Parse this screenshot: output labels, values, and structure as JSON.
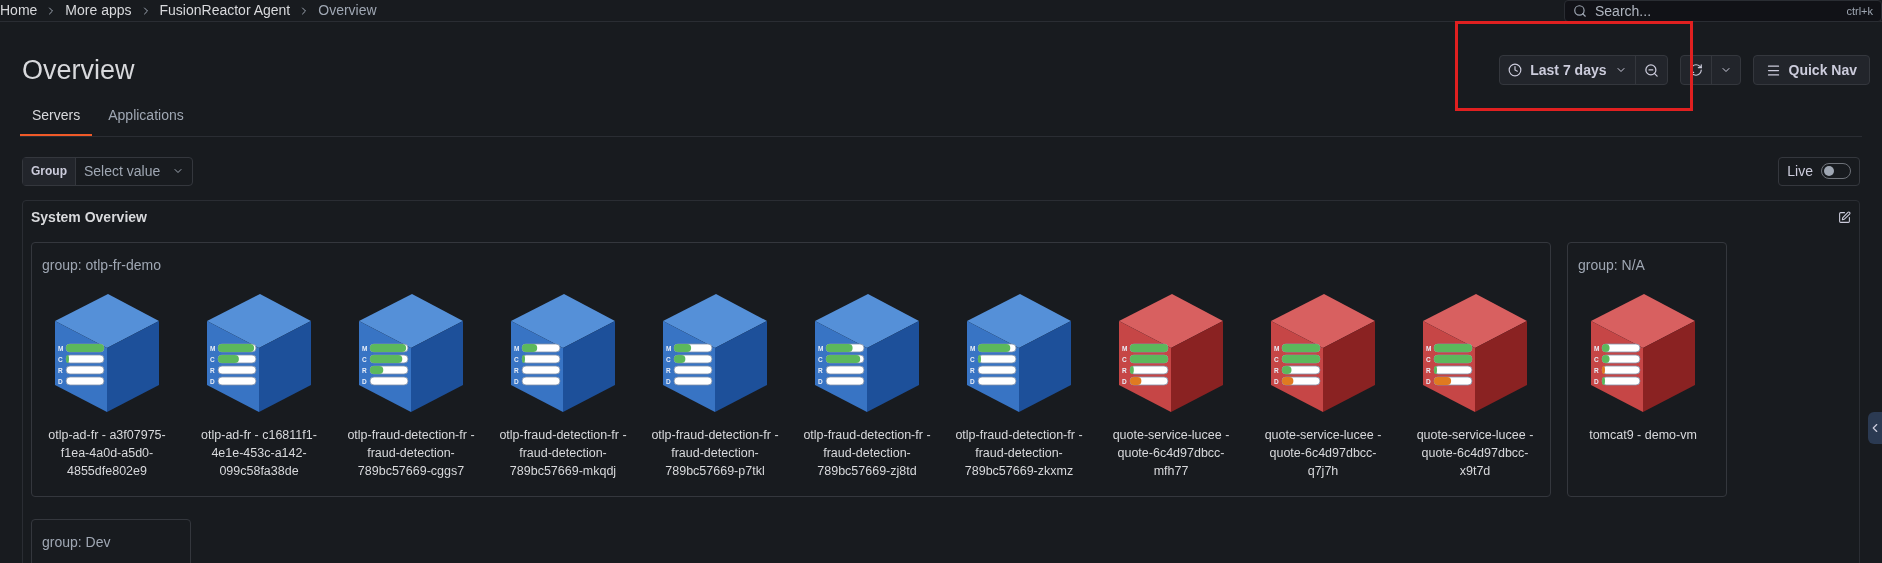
{
  "breadcrumbs": [
    "Home",
    "More apps",
    "FusionReactor Agent",
    "Overview"
  ],
  "search": {
    "placeholder": "Search...",
    "shortcut": "ctrl+k"
  },
  "title": "Overview",
  "toolbar": {
    "time_range": "Last 7 days",
    "quick_nav": "Quick Nav"
  },
  "tabs": [
    {
      "label": "Servers",
      "selected": true
    },
    {
      "label": "Applications",
      "selected": false
    }
  ],
  "filter": {
    "label": "Group",
    "placeholder": "Select value"
  },
  "live": {
    "label": "Live",
    "on": false
  },
  "panel": {
    "title": "System Overview",
    "groups": [
      {
        "title": "group: otlp-fr-demo",
        "servers": [
          {
            "name": "otlp-ad-fr - a3f07975-f1ea-4a0d-a5d0-4855dfe802e9",
            "kind": "ok",
            "meters": [
              {
                "label": "M",
                "level": 1,
                "kind": "normal"
              },
              {
                "label": "C",
                "level": 0.06,
                "kind": "normal"
              },
              {
                "label": "R",
                "level": 0
              },
              {
                "label": "D",
                "level": 0
              }
            ]
          },
          {
            "name": "otlp-ad-fr - c16811f1-4e1e-453c-a142-099c58fa38de",
            "kind": "ok",
            "meters": [
              {
                "label": "M",
                "level": 0.95,
                "kind": "normal"
              },
              {
                "label": "C",
                "level": 0.55,
                "kind": "normal"
              },
              {
                "label": "R",
                "level": 0
              },
              {
                "label": "D",
                "level": 0
              }
            ]
          },
          {
            "name": "otlp-fraud-detection-fr - fraud-detection-789bc57669-cggs7",
            "kind": "ok",
            "meters": [
              {
                "label": "M",
                "level": 0.95,
                "kind": "normal"
              },
              {
                "label": "C",
                "level": 0.85,
                "kind": "normal"
              },
              {
                "label": "R",
                "level": 0.35,
                "kind": "normal"
              },
              {
                "label": "D",
                "level": 0
              }
            ]
          },
          {
            "name": "otlp-fraud-detection-fr - fraud-detection-789bc57669-mkqdj",
            "kind": "ok",
            "meters": [
              {
                "label": "M",
                "level": 0.4,
                "kind": "normal"
              },
              {
                "label": "C",
                "level": 0.06,
                "kind": "normal"
              },
              {
                "label": "R",
                "level": 0
              },
              {
                "label": "D",
                "level": 0
              }
            ]
          },
          {
            "name": "otlp-fraud-detection-fr - fraud-detection-789bc57669-p7tkl",
            "kind": "ok",
            "meters": [
              {
                "label": "M",
                "level": 0.45,
                "kind": "normal"
              },
              {
                "label": "C",
                "level": 0.3,
                "kind": "normal"
              },
              {
                "label": "R",
                "level": 0
              },
              {
                "label": "D",
                "level": 0
              }
            ]
          },
          {
            "name": "otlp-fraud-detection-fr - fraud-detection-789bc57669-zj8td",
            "kind": "ok",
            "meters": [
              {
                "label": "M",
                "level": 0.7,
                "kind": "normal"
              },
              {
                "label": "C",
                "level": 0.9,
                "kind": "normal"
              },
              {
                "label": "R",
                "level": 0
              },
              {
                "label": "D",
                "level": 0
              }
            ]
          },
          {
            "name": "otlp-fraud-detection-fr - fraud-detection-789bc57669-zkxmz",
            "kind": "ok",
            "meters": [
              {
                "label": "M",
                "level": 0.85,
                "kind": "normal"
              },
              {
                "label": "C",
                "level": 0.06,
                "kind": "normal"
              },
              {
                "label": "R",
                "level": 0
              },
              {
                "label": "D",
                "level": 0
              }
            ]
          },
          {
            "name": "quote-service-lucee - quote-6c4d97dbcc-mfh77",
            "kind": "critical",
            "meters": [
              {
                "label": "M",
                "level": 1,
                "kind": "normal"
              },
              {
                "label": "C",
                "level": 1,
                "kind": "normal"
              },
              {
                "label": "R",
                "level": 0.1,
                "kind": "normal"
              },
              {
                "label": "D",
                "level": 0.3,
                "kind": "warning"
              }
            ]
          },
          {
            "name": "quote-service-lucee - quote-6c4d97dbcc-q7j7h",
            "kind": "critical",
            "meters": [
              {
                "label": "M",
                "level": 1,
                "kind": "normal"
              },
              {
                "label": "C",
                "level": 1,
                "kind": "normal"
              },
              {
                "label": "R",
                "level": 0.25,
                "kind": "normal"
              },
              {
                "label": "D",
                "level": 0.3,
                "kind": "warning"
              }
            ]
          },
          {
            "name": "quote-service-lucee - quote-6c4d97dbcc-x9t7d",
            "kind": "critical",
            "meters": [
              {
                "label": "M",
                "level": 1,
                "kind": "normal"
              },
              {
                "label": "C",
                "level": 1,
                "kind": "normal"
              },
              {
                "label": "R",
                "level": 0.06,
                "kind": "normal"
              },
              {
                "label": "D",
                "level": 0.45,
                "kind": "warning"
              }
            ]
          }
        ]
      },
      {
        "title": "group: N/A",
        "servers": [
          {
            "name": "tomcat9 - demo-vm",
            "kind": "critical",
            "meters": [
              {
                "label": "M",
                "level": 0.2,
                "kind": "normal"
              },
              {
                "label": "C",
                "level": 0.2,
                "kind": "normal"
              },
              {
                "label": "R",
                "level": 0.06,
                "kind": "warning"
              },
              {
                "label": "D",
                "level": 0.04,
                "kind": "normal"
              }
            ]
          }
        ]
      },
      {
        "title": "group: Dev"
      }
    ]
  }
}
